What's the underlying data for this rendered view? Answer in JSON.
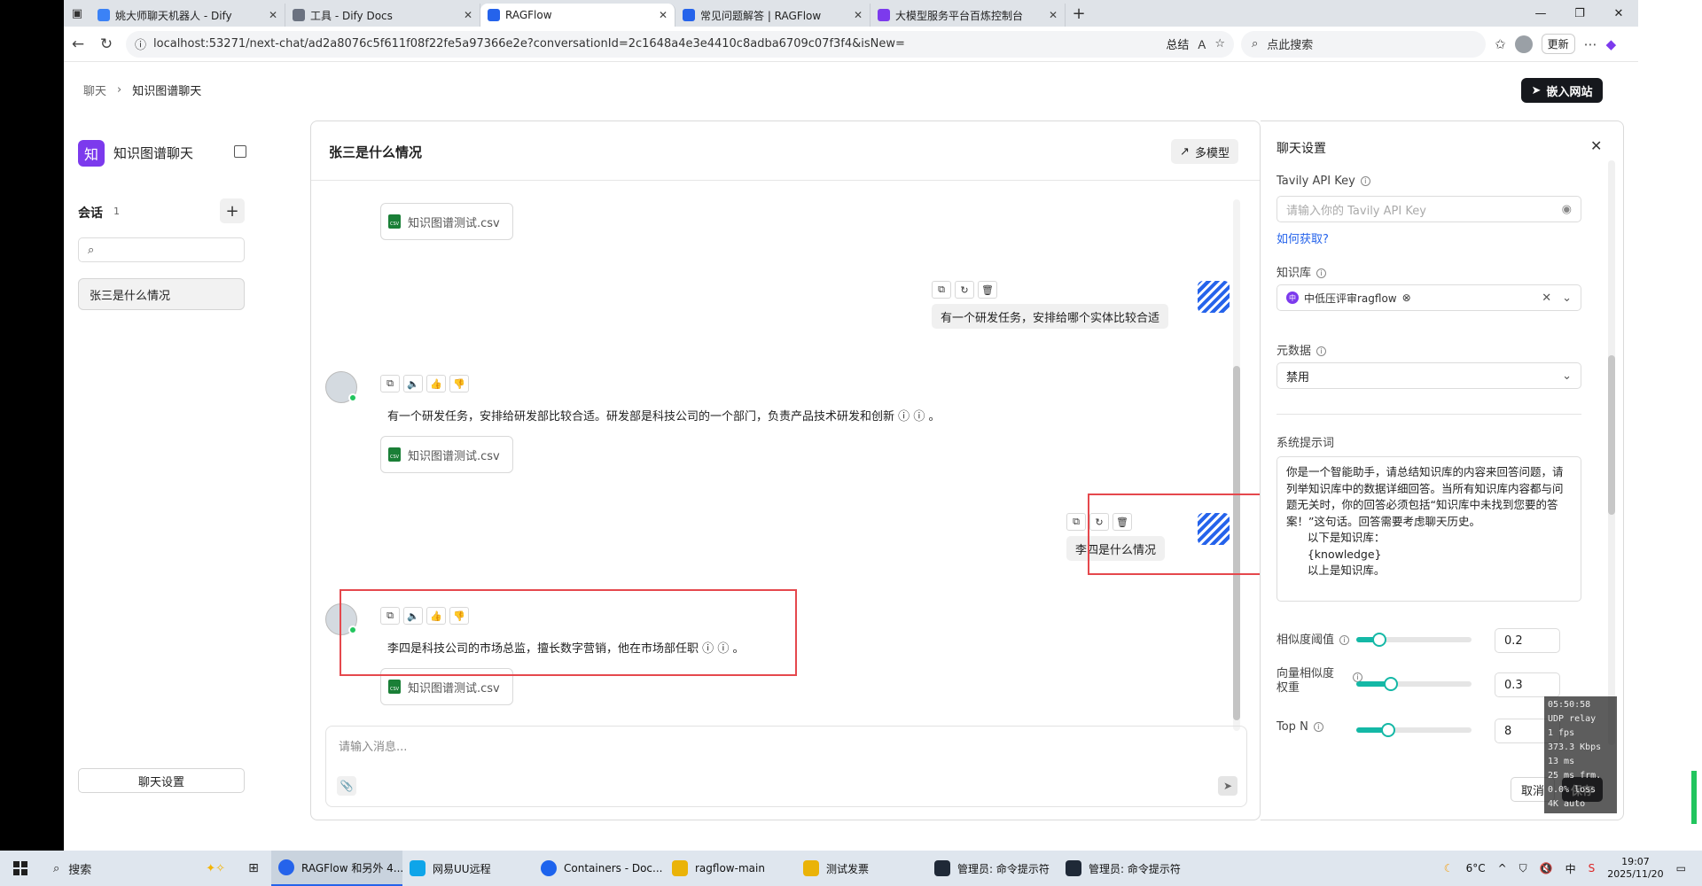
{
  "browser": {
    "tabs": [
      {
        "title": "姚大师聊天机器人 - Dify",
        "color": "#3b82f6"
      },
      {
        "title": "工具 - Dify Docs",
        "color": "#6b7280"
      },
      {
        "title": "RAGFlow",
        "color": "#2563eb"
      },
      {
        "title": "常见问题解答 | RAGFlow",
        "color": "#2563eb"
      },
      {
        "title": "大模型服务平台百炼控制台",
        "color": "#7c3aed"
      }
    ],
    "url": "localhost:53271/next-chat/ad2a8076c5f611f08f22fe5a97366e2e?conversationId=2c1648a4e3e4410c8adba6709c07f3f4&isNew=",
    "summary_label": "总结",
    "search_placeholder": "点此搜索",
    "update_label": "更新"
  },
  "breadcrumb": {
    "root": "聊天",
    "current": "知识图谱聊天"
  },
  "embed_button": "嵌入网站",
  "sidebar": {
    "app_logo": "知",
    "app_name": "知识图谱聊天",
    "sessions_label": "会话",
    "sessions_count": "1",
    "items": [
      {
        "label": "张三是什么情况"
      }
    ],
    "settings_button": "聊天设置"
  },
  "chat": {
    "title": "张三是什么情况",
    "multi_model_button": "多模型",
    "file_name": "知识图谱测试.csv",
    "messages": [
      {
        "role": "user",
        "text": "有一个研发任务，安排给哪个实体比较合适"
      },
      {
        "role": "assistant",
        "text": "有一个研发任务，安排给研发部比较合适。研发部是科技公司的一个部门，负责产品技术研发和创新"
      },
      {
        "role": "user",
        "text": "李四是什么情况"
      },
      {
        "role": "assistant",
        "text": "李四是科技公司的市场总监，擅长数字营销，他在市场部任职"
      }
    ],
    "input_placeholder": "请输入消息..."
  },
  "settings": {
    "title": "聊天设置",
    "tavily_label": "Tavily API Key",
    "tavily_placeholder": "请输入你的 Tavily API Key",
    "how_to_get": "如何获取?",
    "kb_label": "知识库",
    "kb_value": "中低压评审ragflow",
    "kb_icon": "中",
    "metadata_label": "元数据",
    "metadata_value": "禁用",
    "prompt_label": "系统提示词",
    "prompt_text": "你是一个智能助手，请总结知识库的内容来回答问题，请列举知识库中的数据详细回答。当所有知识库内容都与问题无关时，你的回答必须包括“知识库中未找到您要的答案！”这句话。回答需要考虑聊天历史。\n      以下是知识库：\n      {knowledge}\n      以上是知识库。",
    "similarity_label": "相似度阈值",
    "similarity_value": "0.2",
    "vector_label_1": "向量相似度",
    "vector_label_2": "权重",
    "vector_value": "0.3",
    "topn_label": "Top N",
    "topn_value": "8",
    "cancel": "取消",
    "save": "保存"
  },
  "stats_overlay": [
    "05:50:58",
    "UDP relay",
    "1 fps",
    "373.3 Kbps",
    "13 ms",
    "25 ms frm.",
    "0.0% loss",
    "4K auto"
  ],
  "taskbar": {
    "search": "搜索",
    "items": [
      {
        "label": "RAGFlow 和另外 4...",
        "color": "#2563eb"
      },
      {
        "label": "网易UU远程",
        "color": "#0ea5e9"
      },
      {
        "label": "Containers - Doc...",
        "color": "#1d63ed"
      },
      {
        "label": "ragflow-main",
        "color": "#eab308"
      },
      {
        "label": "测试发票",
        "color": "#eab308"
      },
      {
        "label": "管理员: 命令提示符",
        "color": "#1f2937"
      },
      {
        "label": "管理员: 命令提示符",
        "color": "#1f2937"
      }
    ],
    "weather": "6°C",
    "ime": "中",
    "time": "19:07",
    "date": "2025/11/20"
  }
}
